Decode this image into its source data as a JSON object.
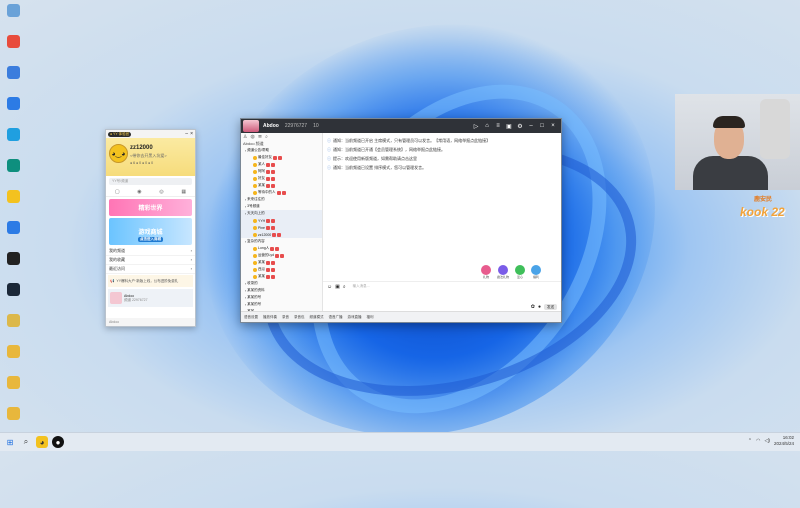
{
  "desktop": {
    "icons": [
      {
        "label": "",
        "icon": "recycle-bin-icon",
        "color": "#6aa2d8"
      },
      {
        "label": "",
        "icon": "app-icon",
        "color": "#e84c3d"
      },
      {
        "label": "",
        "icon": "app-icon",
        "color": "#3b7ddd"
      },
      {
        "label": "",
        "icon": "app-icon",
        "color": "#2c7be5"
      },
      {
        "label": "",
        "icon": "edge-icon",
        "color": "#1f9fe0"
      },
      {
        "label": "",
        "icon": "app-icon",
        "color": "#0e8f7e"
      },
      {
        "label": "",
        "icon": "app-icon",
        "color": "#f3c21f"
      },
      {
        "label": "",
        "icon": "kook-icon",
        "color": "#2c7be5"
      },
      {
        "label": "",
        "icon": "app-icon",
        "color": "#222222"
      },
      {
        "label": "",
        "icon": "steam-icon",
        "color": "#1b2838"
      },
      {
        "label": "",
        "icon": "app-icon",
        "color": "#dcb84a"
      },
      {
        "label": "",
        "icon": "folder-icon",
        "color": "#e8b73c"
      },
      {
        "label": "",
        "icon": "folder-icon",
        "color": "#e8b73c"
      },
      {
        "label": "",
        "icon": "folder-icon",
        "color": "#e8b73c"
      },
      {
        "label": "",
        "icon": "folder-icon",
        "color": "#e8b73c"
      }
    ]
  },
  "yy_small": {
    "tag": "● YY 体验官",
    "username": "zz12000",
    "signature": "<带你去开黑入坑爱>",
    "stats": "● 6   ● 0   ● 0   ● 0",
    "search_placeholder": "YY号/频道",
    "banner1": "精彩世界",
    "banner2": "游戏商城",
    "banner2_sub": "点击进入商城",
    "menu": [
      "我的频道",
      "我的收藏",
      "最近访问"
    ],
    "notice": "YY爆料大户·新版上线，公布进阶免费礼",
    "channel_name": "Abdoo",
    "channel_id": "频道 22976727",
    "bottom": "Abdoo"
  },
  "yy_main": {
    "channel_title": "Abdoo",
    "channel_id": "22976727",
    "member_count": "10",
    "list_title": "Abdoo 频道",
    "list_rows": [
      {
        "text": "频道公告/帮助",
        "sub": false,
        "sel": false
      },
      {
        "text": "最佳好友",
        "sub": true,
        "sel": false
      },
      {
        "text": "某人",
        "sub": true,
        "sel": false
      },
      {
        "text": "阿阿",
        "sub": true,
        "sel": false
      },
      {
        "text": "好友",
        "sub": true,
        "sel": false
      },
      {
        "text": "某某",
        "sub": true,
        "sel": false
      },
      {
        "text": "等待中的人",
        "sub": true,
        "sel": false
      },
      {
        "text": "来来往往的",
        "sub": false,
        "sel": false
      },
      {
        "text": "3号频道",
        "sub": false,
        "sel": false
      },
      {
        "text": "天天向上的",
        "sub": false,
        "sel": true
      },
      {
        "text": "YYH",
        "sub": true,
        "sel": true
      },
      {
        "text": "Pine",
        "sub": true,
        "sel": true
      },
      {
        "text": "zz12000",
        "sub": true,
        "sel": true
      },
      {
        "text": "复杂的内容",
        "sub": false,
        "sel": false
      },
      {
        "text": "Long人",
        "sub": true,
        "sel": false
      },
      {
        "text": "运营的Lyd",
        "sub": true,
        "sel": false
      },
      {
        "text": "某某",
        "sub": true,
        "sel": false
      },
      {
        "text": "西瓜",
        "sub": true,
        "sel": false
      },
      {
        "text": "某某",
        "sub": true,
        "sel": false
      },
      {
        "text": "收录的",
        "sub": false,
        "sel": false
      },
      {
        "text": "某某的资料",
        "sub": false,
        "sel": false
      },
      {
        "text": "某某的号",
        "sub": false,
        "sel": false
      },
      {
        "text": "某某的号",
        "sub": false,
        "sel": false
      },
      {
        "text": "某某",
        "sub": false,
        "sel": false
      }
    ],
    "messages": [
      "通知：当前频道已开启 主席模式，只有管理员可以发言。【常用语，网络举报点此链接】",
      "通知：当前频道已开通【会员管理系统】，网络举报点此链接。",
      "提示：欢迎使用新版频道，如需帮助请点击这里",
      "通知：当前频道已设置 排序模式，您可以管理发言。"
    ],
    "gifts": [
      "礼物",
      "魔法礼物",
      "爱心",
      "福利"
    ],
    "input_placeholder": "输入消息...",
    "send_label": "发送",
    "bottom_items": [
      "语音设置",
      "播放伴奏",
      "录音",
      "录音包",
      "频道模式",
      "语音广播",
      "游戏直播",
      "福利"
    ]
  },
  "webcam": {
    "brand_top": "鹿安民",
    "brand_main": "kook 22"
  },
  "taskbar": {
    "time": "16:02",
    "date": "2024/5/24"
  }
}
